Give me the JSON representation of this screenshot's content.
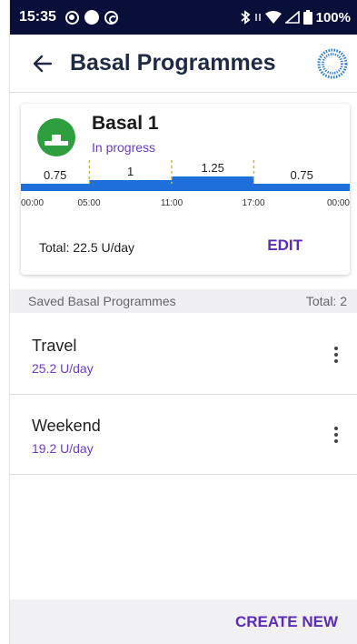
{
  "status_bar": {
    "time": "15:35",
    "battery": "100%",
    "icons": [
      "record-icon",
      "circle-icon",
      "sync-icon",
      "bluetooth-icon",
      "wifi-icon",
      "signal-icon",
      "battery-icon"
    ]
  },
  "header": {
    "title": "Basal Programmes",
    "back_icon": "arrow-left-icon",
    "pod_icon": "pod-status-icon"
  },
  "active_programme": {
    "name": "Basal 1",
    "status": "In progress",
    "total": "Total: 22.5 U/day",
    "edit_label": "EDIT",
    "segments": [
      {
        "start": "00:00",
        "end": "05:00",
        "rate": "0.75"
      },
      {
        "start": "05:00",
        "end": "11:00",
        "rate": "1"
      },
      {
        "start": "11:00",
        "end": "17:00",
        "rate": "1.25"
      },
      {
        "start": "17:00",
        "end": "00:00",
        "rate": "0.75"
      }
    ],
    "time_labels": [
      "00:00",
      "05:00",
      "11:00",
      "17:00",
      "00:00"
    ]
  },
  "saved": {
    "header": "Saved Basal Programmes",
    "count": "Total: 2",
    "items": [
      {
        "name": "Travel",
        "rate": "25.2 U/day"
      },
      {
        "name": "Weekend",
        "rate": "19.2 U/day"
      }
    ]
  },
  "footer": {
    "create_label": "CREATE NEW"
  },
  "colors": {
    "status_bar": "#0a0f3a",
    "accent_purple": "#5a2db8",
    "bar_blue": "#1e6fd9",
    "basal_green": "#2f9e3e",
    "divider_gold": "#c9b94a"
  }
}
